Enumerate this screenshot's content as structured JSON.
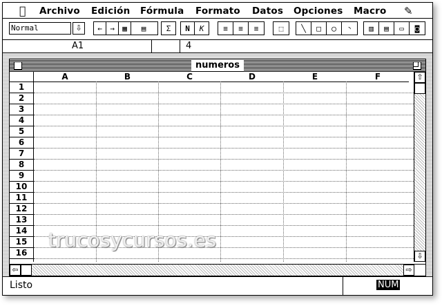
{
  "menubar": {
    "items": [
      "Archivo",
      "Edición",
      "Fórmula",
      "Formato",
      "Datos",
      "Opciones",
      "Macro"
    ]
  },
  "toolbar": {
    "style_value": "Normal",
    "sum_symbol": "Σ",
    "bold": "N",
    "italic": "K"
  },
  "formula_bar": {
    "cell_reference": "A1",
    "content": "4"
  },
  "window": {
    "title": "numeros"
  },
  "sheet": {
    "columns": [
      "A",
      "B",
      "C",
      "D",
      "E",
      "F"
    ],
    "rows": [
      "1",
      "2",
      "3",
      "4",
      "5",
      "6",
      "7",
      "8",
      "9",
      "10",
      "11",
      "12",
      "13",
      "14",
      "15",
      "16"
    ]
  },
  "status_bar": {
    "message": "Listo",
    "num_indicator": "NUM"
  },
  "watermark": "trucosycursos.es"
}
